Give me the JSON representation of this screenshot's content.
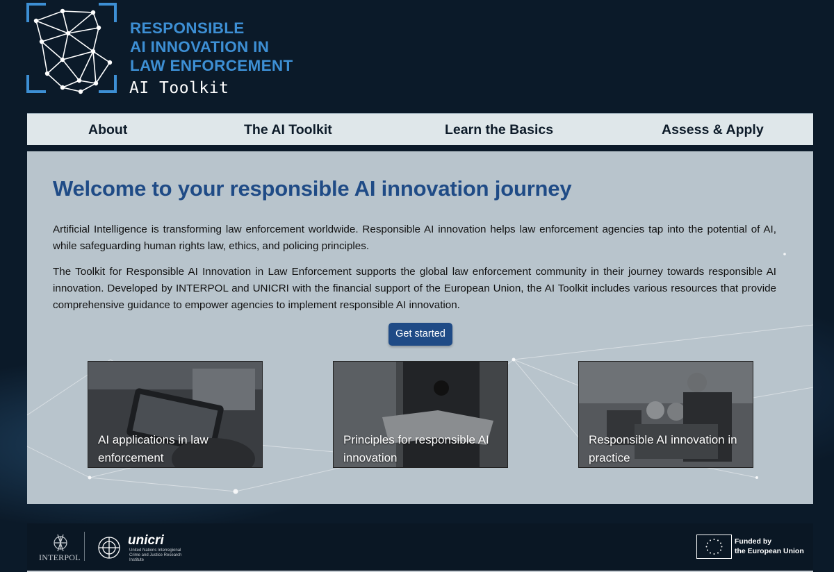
{
  "brand": {
    "title": "RESPONSIBLE\nAI INNOVATION IN\nLAW ENFORCEMENT",
    "subtitle": "AI Toolkit"
  },
  "nav": {
    "items": [
      {
        "label": "About"
      },
      {
        "label": "The AI Toolkit"
      },
      {
        "label": "Learn the Basics"
      },
      {
        "label": "Assess & Apply"
      }
    ]
  },
  "main": {
    "heading": "Welcome to your responsible AI innovation journey",
    "paragraphs": [
      "Artificial Intelligence is transforming law enforcement worldwide. Responsible AI innovation helps law enforcement agencies tap into the potential of AI, while safeguarding human rights law, ethics, and policing principles.",
      "The Toolkit for Responsible AI Innovation in Law Enforcement supports the global law enforcement community in their journey towards responsible AI innovation. Developed by INTERPOL and UNICRI with the financial support of the European Union, the AI Toolkit includes various resources that provide comprehensive guidance to empower agencies to implement responsible AI innovation."
    ],
    "cta_label": "Get started",
    "cards": [
      {
        "label": "AI applications in law enforcement"
      },
      {
        "label": "Principles for responsible AI innovation"
      },
      {
        "label": "Responsible AI innovation in practice"
      }
    ]
  },
  "footer": {
    "interpol_label": "INTERPOL",
    "unicri_name": "unicri",
    "unicri_subtitle": "United Nations Interregional Crime and Justice Research Institute",
    "eu_label": "Funded by\nthe European Union"
  },
  "colors": {
    "page_bg": "#0b1a29",
    "brand_blue": "#3d8fd4",
    "heading_blue": "#1f4b86",
    "nav_bg": "#dfe7ea",
    "panel_bg": "#b8c4cc"
  }
}
